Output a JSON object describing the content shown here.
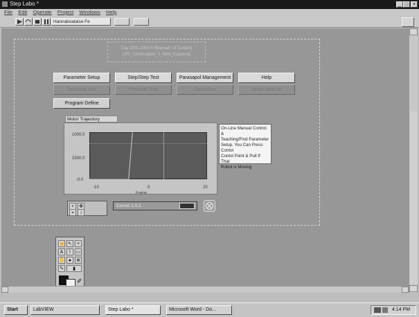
{
  "window": {
    "title": "Step Labo *"
  },
  "menu": [
    "File",
    "Edit",
    "Operate",
    "Project",
    "Windows",
    "Help"
  ],
  "toolbar": {
    "font_select": "Hannaboalaise Fe"
  },
  "panel": {
    "message_line1": "Day 2001-2000-0 (Manual? of Ouitput)",
    "message_line2": "(.P0_Continuation_0_NA0_Exposed)",
    "buttons_row1": [
      "Parameter Setup",
      "Step/Step Test",
      "Parasapol Management",
      "Help"
    ],
    "buttons_row2": [
      "Teaching Pad",
      "Physical Test",
      "Operation",
      "Move Step-Mt"
    ],
    "program_button": "Program Define"
  },
  "chart": {
    "title": "Motor Trajectory",
    "y_ticks": [
      "1000.0",
      "1500.0",
      "-0.0"
    ],
    "x_ticks": [
      "-10",
      "0",
      "20"
    ],
    "x_label": "Frame",
    "status_readout": "Cursor 1  0.1"
  },
  "chart_data": {
    "type": "line",
    "title": "Motor Trajectory",
    "xlabel": "Frame",
    "ylabel": "",
    "xlim": [
      -10,
      20
    ],
    "ylim": [
      -0.0,
      1000.0
    ],
    "series": [
      {
        "x": [
          -10,
          0,
          0.5,
          1
        ],
        "y": [
          0,
          0,
          500,
          1000
        ]
      }
    ]
  },
  "notes": {
    "text": "On-Line Manual Control &\nTeaching/Find Parameter\nSetup. You Can Press\nContol\nContol Point & Pull If That\nRobot is Moving"
  },
  "taskbar": {
    "start": "Start",
    "items": [
      "LabVIEW",
      "Step Labo *",
      "Microsoft Word - Do..."
    ],
    "clock": "4:14 PM"
  }
}
